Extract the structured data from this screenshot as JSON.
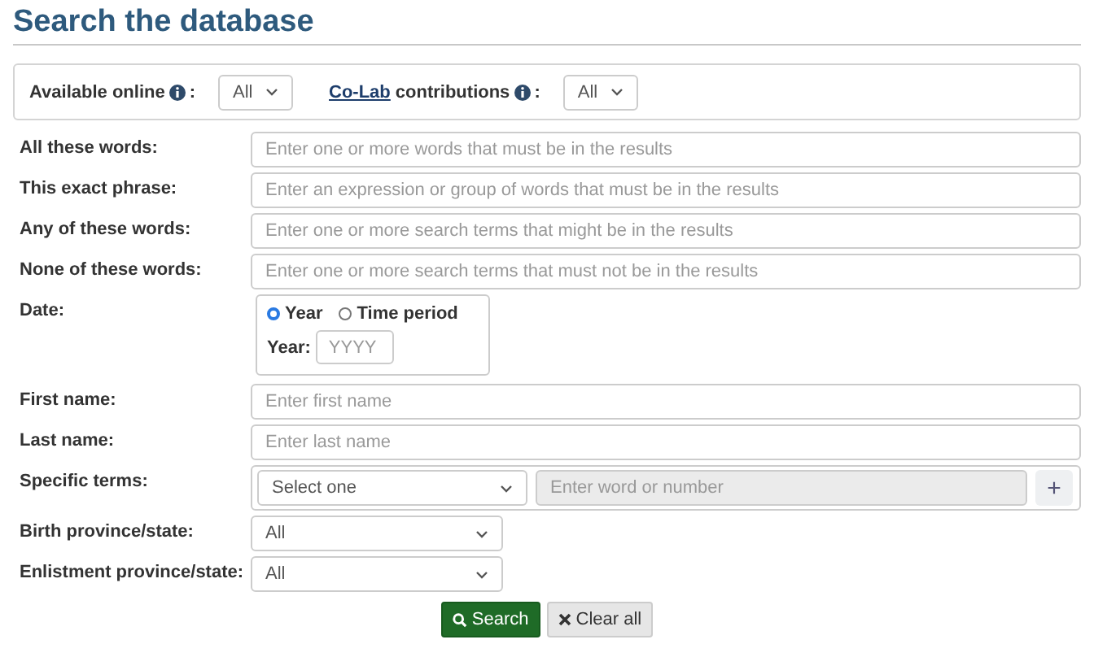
{
  "title": "Search the database",
  "filters": [
    {
      "label": "Available online",
      "suffix": ":",
      "value": "All"
    },
    {
      "link": "Co-Lab",
      "label": "contributions",
      "suffix": ":",
      "value": "All"
    }
  ],
  "fields": [
    {
      "kind": "text",
      "label": "All these words:",
      "placeholder": "Enter one or more words that must be in the results"
    },
    {
      "kind": "text",
      "label": "This exact phrase:",
      "placeholder": "Enter an expression or group of words that must be in the results"
    },
    {
      "kind": "text",
      "label": "Any of these words:",
      "placeholder": "Enter one or more search terms that might be in the results"
    },
    {
      "kind": "text",
      "label": "None of these words:",
      "placeholder": "Enter one or more search terms that must not be in the results"
    },
    {
      "kind": "date",
      "label": "Date:",
      "options": [
        {
          "label": "Year",
          "selected": true
        },
        {
          "label": "Time period",
          "selected": false
        }
      ],
      "year_label": "Year:",
      "placeholder": "YYYY"
    },
    {
      "kind": "text",
      "label": "First name:",
      "placeholder": "Enter first name"
    },
    {
      "kind": "text",
      "label": "Last name:",
      "placeholder": "Enter last name"
    },
    {
      "kind": "terms",
      "label": "Specific terms:",
      "value": "Select one",
      "placeholder": "Enter word or number",
      "add": "+"
    },
    {
      "kind": "select",
      "label": "Birth province/state:",
      "value": "All"
    },
    {
      "kind": "select",
      "label": "Enlistment province/state:",
      "value": "All"
    }
  ],
  "buttons": [
    {
      "kind": "search",
      "label": "Search"
    },
    {
      "kind": "clear",
      "label": "Clear all"
    }
  ]
}
